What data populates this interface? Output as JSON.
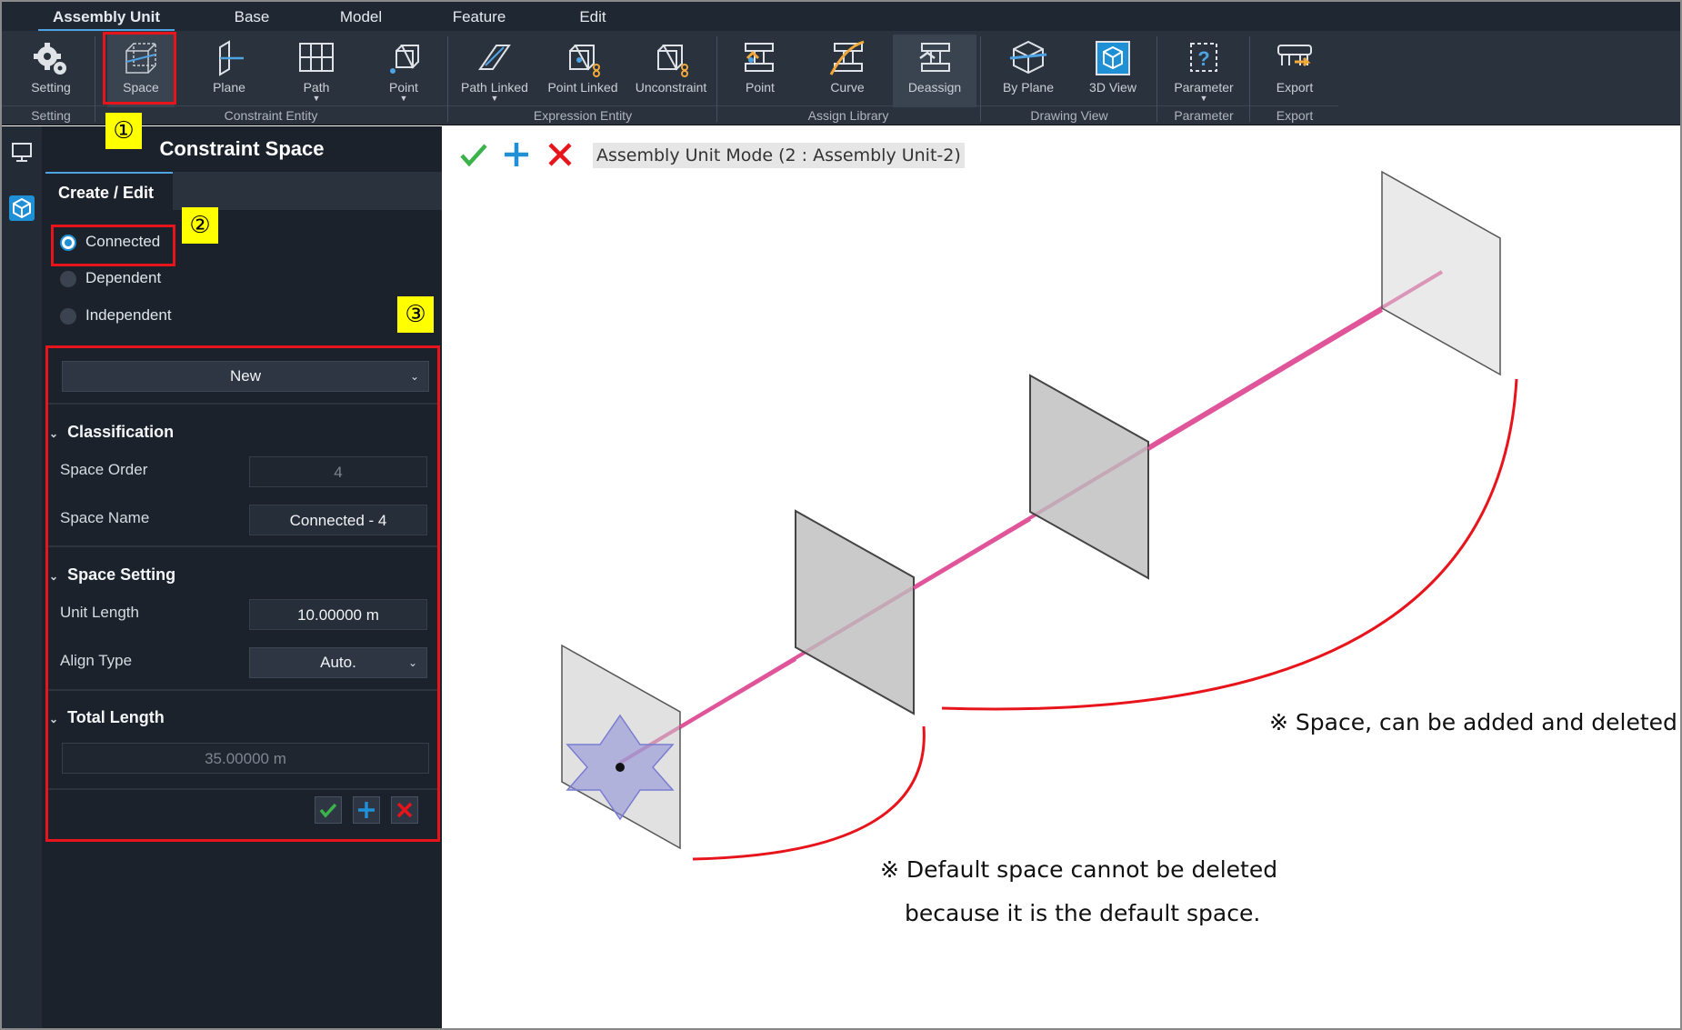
{
  "menu": {
    "tabs": [
      "Assembly Unit",
      "Base",
      "Model",
      "Feature",
      "Edit"
    ]
  },
  "ribbon": {
    "buttons": {
      "setting": "Setting",
      "space": "Space",
      "plane": "Plane",
      "path": "Path",
      "point": "Point",
      "path_linked": "Path Linked",
      "point_linked": "Point Linked",
      "unconstraint": "Unconstraint",
      "lib_point": "Point",
      "curve": "Curve",
      "deassign": "Deassign",
      "by_plane": "By Plane",
      "view_3d": "3D View",
      "parameter": "Parameter",
      "export": "Export"
    },
    "groups": {
      "setting": "Setting",
      "constraint_entity": "Constraint Entity",
      "expression_entity": "Expression Entity",
      "assign_library": "Assign Library",
      "drawing_view": "Drawing View",
      "parameter": "Parameter",
      "export": "Export"
    }
  },
  "panel": {
    "title": "Constraint Space",
    "tab": "Create / Edit",
    "radios": {
      "connected": "Connected",
      "dependent": "Dependent",
      "independent": "Independent"
    },
    "selected_radio": "Connected",
    "mode_select": "New",
    "classification": {
      "header": "Classification",
      "space_order_label": "Space Order",
      "space_order_value": "4",
      "space_name_label": "Space Name",
      "space_name_value": "Connected - 4"
    },
    "space_setting": {
      "header": "Space Setting",
      "unit_length_label": "Unit Length",
      "unit_length_value": "10.00000 m",
      "align_type_label": "Align Type",
      "align_type_value": "Auto."
    },
    "total_length": {
      "header": "Total Length",
      "value": "35.00000 m"
    }
  },
  "annotations": {
    "badge1": "①",
    "badge2": "②",
    "badge3": "③",
    "note_added": "※ Space, can be added and deleted",
    "note_default_1": "※ Default space cannot be deleted",
    "note_default_2": "because it is the default space."
  },
  "canvas": {
    "mode_label": "Assembly Unit Mode (2 : Assembly Unit-2)"
  },
  "colors": {
    "annotation_red": "#e8141c",
    "badge_yellow": "#ffff00",
    "path_line": "#e0559a",
    "accent_blue": "#1f8fd6",
    "confirm_green": "#3bb34a"
  }
}
